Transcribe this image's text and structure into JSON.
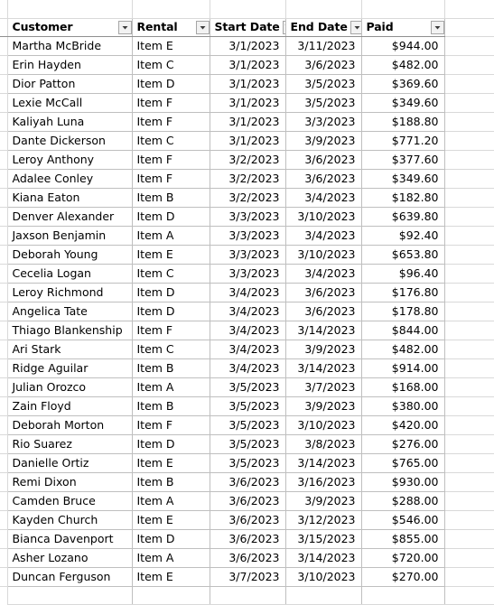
{
  "app": {
    "type": "spreadsheet-table",
    "sort_state": "Start Date ascending"
  },
  "table": {
    "columns": [
      {
        "label": "Customer",
        "align": "left",
        "filter_icon": "filter-dropdown-icon"
      },
      {
        "label": "Rental",
        "align": "left",
        "filter_icon": "filter-dropdown-icon"
      },
      {
        "label": "Start Date",
        "align": "right",
        "filter_icon": "sort-ascending-filter-icon"
      },
      {
        "label": "End Date",
        "align": "right",
        "filter_icon": "filter-dropdown-icon"
      },
      {
        "label": "Paid",
        "align": "right",
        "filter_icon": "filter-dropdown-icon"
      }
    ],
    "rows": [
      {
        "customer": "Martha McBride",
        "rental": "Item E",
        "start": "3/1/2023",
        "end": "3/11/2023",
        "paid": "$944.00"
      },
      {
        "customer": "Erin Hayden",
        "rental": "Item C",
        "start": "3/1/2023",
        "end": "3/6/2023",
        "paid": "$482.00"
      },
      {
        "customer": "Dior Patton",
        "rental": "Item D",
        "start": "3/1/2023",
        "end": "3/5/2023",
        "paid": "$369.60"
      },
      {
        "customer": "Lexie McCall",
        "rental": "Item F",
        "start": "3/1/2023",
        "end": "3/5/2023",
        "paid": "$349.60"
      },
      {
        "customer": "Kaliyah Luna",
        "rental": "Item F",
        "start": "3/1/2023",
        "end": "3/3/2023",
        "paid": "$188.80"
      },
      {
        "customer": "Dante Dickerson",
        "rental": "Item C",
        "start": "3/1/2023",
        "end": "3/9/2023",
        "paid": "$771.20"
      },
      {
        "customer": "Leroy Anthony",
        "rental": "Item F",
        "start": "3/2/2023",
        "end": "3/6/2023",
        "paid": "$377.60"
      },
      {
        "customer": "Adalee Conley",
        "rental": "Item F",
        "start": "3/2/2023",
        "end": "3/6/2023",
        "paid": "$349.60"
      },
      {
        "customer": "Kiana Eaton",
        "rental": "Item B",
        "start": "3/2/2023",
        "end": "3/4/2023",
        "paid": "$182.80"
      },
      {
        "customer": "Denver Alexander",
        "rental": "Item D",
        "start": "3/3/2023",
        "end": "3/10/2023",
        "paid": "$639.80"
      },
      {
        "customer": "Jaxson Benjamin",
        "rental": "Item A",
        "start": "3/3/2023",
        "end": "3/4/2023",
        "paid": "$92.40"
      },
      {
        "customer": "Deborah Young",
        "rental": "Item E",
        "start": "3/3/2023",
        "end": "3/10/2023",
        "paid": "$653.80"
      },
      {
        "customer": "Cecelia Logan",
        "rental": "Item C",
        "start": "3/3/2023",
        "end": "3/4/2023",
        "paid": "$96.40"
      },
      {
        "customer": "Leroy Richmond",
        "rental": "Item D",
        "start": "3/4/2023",
        "end": "3/6/2023",
        "paid": "$176.80"
      },
      {
        "customer": "Angelica Tate",
        "rental": "Item D",
        "start": "3/4/2023",
        "end": "3/6/2023",
        "paid": "$178.80"
      },
      {
        "customer": "Thiago Blankenship",
        "rental": "Item F",
        "start": "3/4/2023",
        "end": "3/14/2023",
        "paid": "$844.00"
      },
      {
        "customer": "Ari Stark",
        "rental": "Item C",
        "start": "3/4/2023",
        "end": "3/9/2023",
        "paid": "$482.00"
      },
      {
        "customer": "Ridge Aguilar",
        "rental": "Item B",
        "start": "3/4/2023",
        "end": "3/14/2023",
        "paid": "$914.00"
      },
      {
        "customer": "Julian Orozco",
        "rental": "Item A",
        "start": "3/5/2023",
        "end": "3/7/2023",
        "paid": "$168.00"
      },
      {
        "customer": "Zain Floyd",
        "rental": "Item B",
        "start": "3/5/2023",
        "end": "3/9/2023",
        "paid": "$380.00"
      },
      {
        "customer": "Deborah Morton",
        "rental": "Item F",
        "start": "3/5/2023",
        "end": "3/10/2023",
        "paid": "$420.00"
      },
      {
        "customer": "Rio Suarez",
        "rental": "Item D",
        "start": "3/5/2023",
        "end": "3/8/2023",
        "paid": "$276.00"
      },
      {
        "customer": "Danielle Ortiz",
        "rental": "Item E",
        "start": "3/5/2023",
        "end": "3/14/2023",
        "paid": "$765.00"
      },
      {
        "customer": "Remi Dixon",
        "rental": "Item B",
        "start": "3/6/2023",
        "end": "3/16/2023",
        "paid": "$930.00"
      },
      {
        "customer": "Camden Bruce",
        "rental": "Item A",
        "start": "3/6/2023",
        "end": "3/9/2023",
        "paid": "$288.00"
      },
      {
        "customer": "Kayden Church",
        "rental": "Item E",
        "start": "3/6/2023",
        "end": "3/12/2023",
        "paid": "$546.00"
      },
      {
        "customer": "Bianca Davenport",
        "rental": "Item D",
        "start": "3/6/2023",
        "end": "3/15/2023",
        "paid": "$855.00"
      },
      {
        "customer": "Asher Lozano",
        "rental": "Item A",
        "start": "3/6/2023",
        "end": "3/14/2023",
        "paid": "$720.00"
      },
      {
        "customer": "Duncan Ferguson",
        "rental": "Item E",
        "start": "3/7/2023",
        "end": "3/10/2023",
        "paid": "$270.00"
      }
    ]
  },
  "colors": {
    "grid_light": "#d9d9d9",
    "grid_table": "#bfbfbf",
    "header_rule": "#8f8f8f",
    "filter_button_bg": "#f2f2f2",
    "filter_button_border": "#a6a6a6",
    "text": "#000000",
    "background": "#ffffff"
  }
}
